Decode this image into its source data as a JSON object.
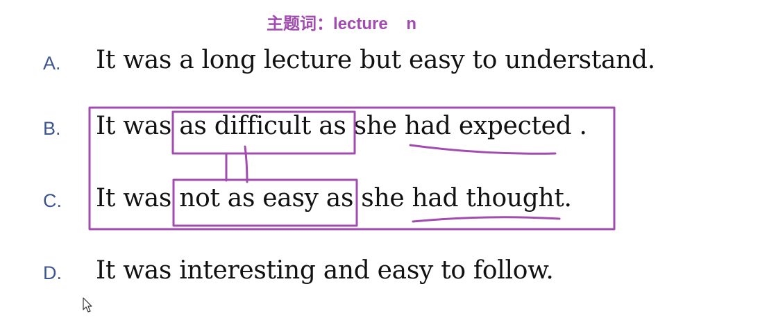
{
  "keyword": "主题词：lecture    n",
  "options": [
    {
      "letter": "A.",
      "text": "It was a long lecture but easy to understand."
    },
    {
      "letter": "B.",
      "text": "It was as difficult as she had expected ."
    },
    {
      "letter": "C.",
      "text": "It was not as easy as she had thought."
    },
    {
      "letter": "D.",
      "text": "It was interesting and easy to follow."
    }
  ],
  "colors": {
    "annotation": "#a24bb0",
    "letters": "#3e5590",
    "text": "#111111"
  },
  "icons": [
    "mouse-pointer-icon"
  ]
}
